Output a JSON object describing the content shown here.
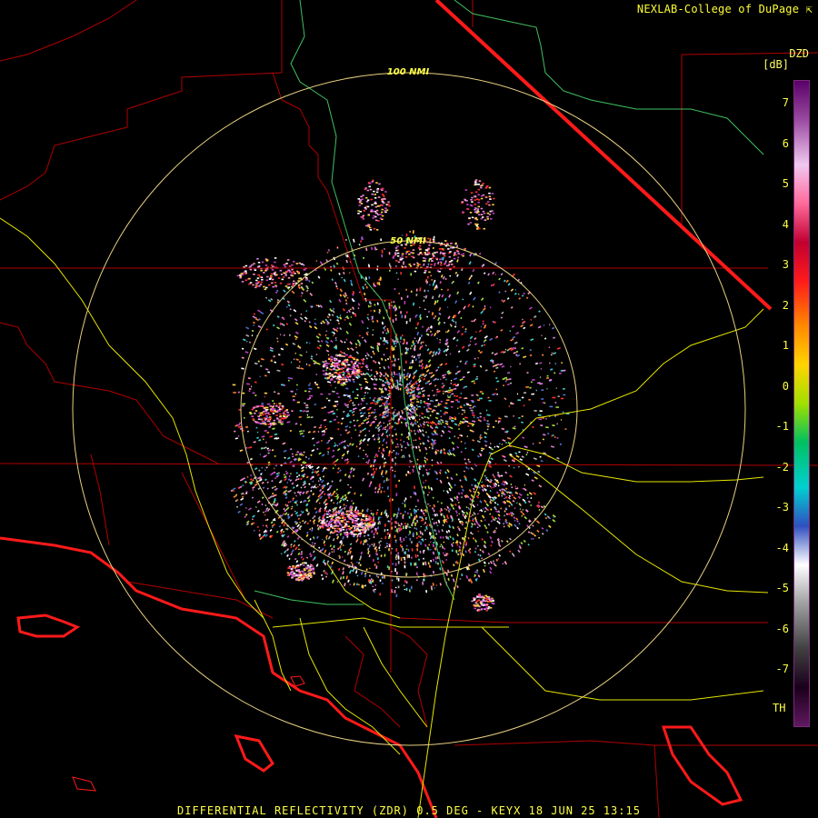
{
  "credit": "NEXLAB-College of DuPage",
  "product_code": "DZD",
  "units": "[dB]",
  "colorbar": {
    "ticks": [
      "7",
      "6",
      "5",
      "4",
      "3",
      "2",
      "1",
      "0",
      "-1",
      "-2",
      "-3",
      "-4",
      "-5",
      "-6",
      "-7"
    ],
    "th_label": "TH",
    "stops": [
      "#5a006a",
      "#9a4aa0",
      "#f0c8f0",
      "#ff6a9a",
      "#c00030",
      "#ff1a1a",
      "#ff8a00",
      "#ffd400",
      "#a0e000",
      "#00c060",
      "#00d0d0",
      "#3050c0",
      "#ffffff",
      "#a0a0a0",
      "#404040",
      "#1a001a",
      "#601860"
    ]
  },
  "range_rings": [
    {
      "label": "100 NMI"
    },
    {
      "label": "50 NMI"
    }
  ],
  "footer": "DIFFERENTIAL REFLECTIVITY (ZDR) 0.5 DEG - KEYX 18 JUN 25 13:15",
  "colors": {
    "county_lines": "#b00000",
    "state_lines": "#ff1a1a",
    "highways": "#e6e600",
    "rivers": "#40c060",
    "rings": "#e8d080"
  }
}
